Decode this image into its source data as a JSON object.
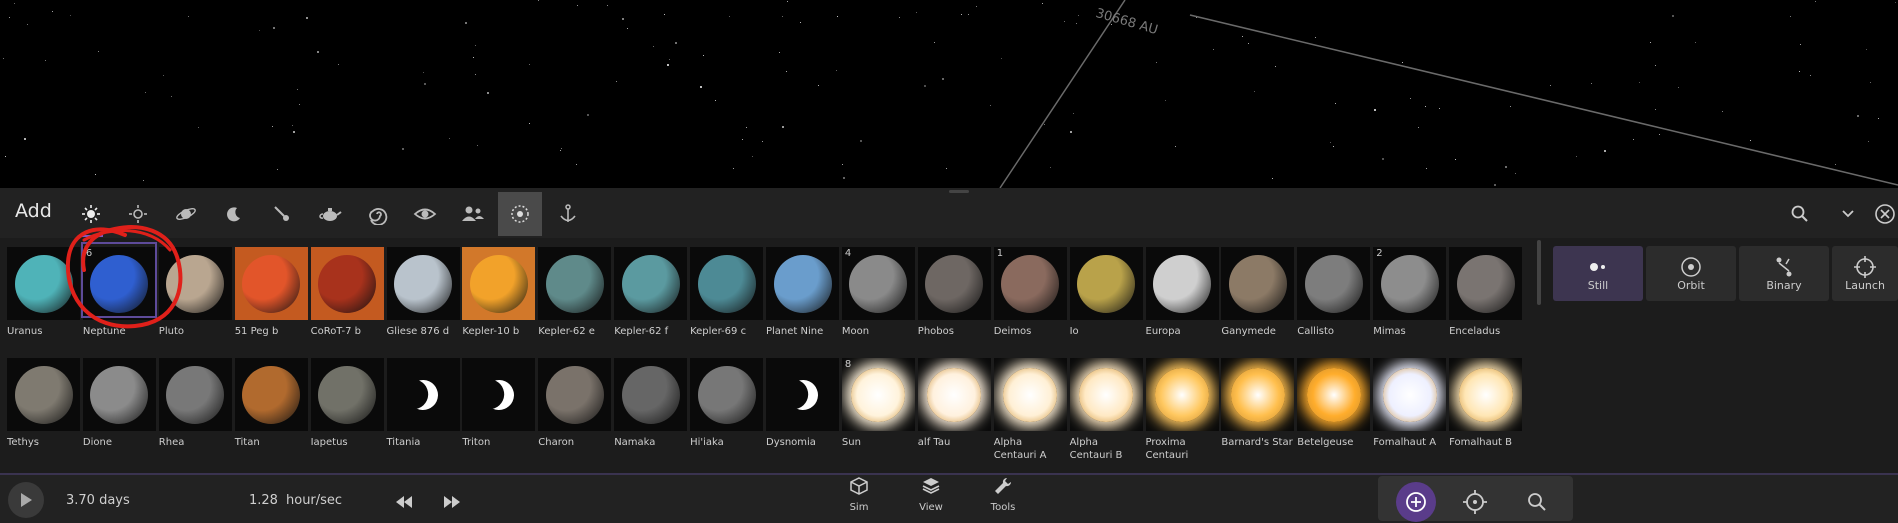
{
  "space": {
    "distance_label": "30668 AU"
  },
  "toolbar": {
    "title": "Add",
    "categories": [
      "stars-galaxies-icon",
      "sun-icon",
      "planet-icon",
      "moon-icon",
      "comet-icon",
      "teapot-icon",
      "spiral-galaxy-icon",
      "eye-icon",
      "people-icon",
      "selected-object-icon",
      "anchor-icon"
    ],
    "search_icon": "search-icon",
    "collapse_icon": "chevron-down-icon",
    "close_icon": "close-icon"
  },
  "objects": [
    {
      "label": "Uranus",
      "color": "#4fb3b8",
      "num": ""
    },
    {
      "label": "Neptune",
      "color": "#2f5fd0",
      "num": "6"
    },
    {
      "label": "Pluto",
      "color": "#b9a690",
      "num": ""
    },
    {
      "label": "51 Peg b",
      "color": "#e2552a",
      "num": ""
    },
    {
      "label": "CoRoT-7 b",
      "color": "#a8321c",
      "num": ""
    },
    {
      "label": "Gliese 876 d",
      "color": "#b9c3cc",
      "num": ""
    },
    {
      "label": "Kepler-10 b",
      "color": "#f2a22a",
      "num": ""
    },
    {
      "label": "Kepler-62 e",
      "color": "#5f8a8a",
      "num": ""
    },
    {
      "label": "Kepler-62 f",
      "color": "#5b9aa0",
      "num": ""
    },
    {
      "label": "Kepler-69 c",
      "color": "#4d8a95",
      "num": ""
    },
    {
      "label": "Planet Nine",
      "color": "#6a9dcc",
      "num": ""
    },
    {
      "label": "Moon",
      "color": "#8a8a8a",
      "num": "4"
    },
    {
      "label": "Phobos",
      "color": "#6e6763",
      "num": ""
    },
    {
      "label": "Deimos",
      "color": "#8a6a5e",
      "num": "1"
    },
    {
      "label": "Io",
      "color": "#b9a24a",
      "num": ""
    },
    {
      "label": "Europa",
      "color": "#cfcfcf",
      "num": ""
    },
    {
      "label": "Ganymede",
      "color": "#8c7a66",
      "num": ""
    },
    {
      "label": "Callisto",
      "color": "#7d7d7d",
      "num": ""
    },
    {
      "label": "Mimas",
      "color": "#8d8d8d",
      "num": "2"
    },
    {
      "label": "Enceladus",
      "color": "#7a7471",
      "num": ""
    },
    {
      "label": "Tethys",
      "color": "#7f7a70",
      "num": ""
    },
    {
      "label": "Dione",
      "color": "#8b8b8b",
      "num": ""
    },
    {
      "label": "Rhea",
      "color": "#787878",
      "num": ""
    },
    {
      "label": "Titan",
      "color": "#b16a2e",
      "num": ""
    },
    {
      "label": "Iapetus",
      "color": "#717168",
      "num": ""
    },
    {
      "label": "Titania",
      "color": "crescent",
      "num": ""
    },
    {
      "label": "Triton",
      "color": "crescent",
      "num": ""
    },
    {
      "label": "Charon",
      "color": "#7a726a",
      "num": ""
    },
    {
      "label": "Namaka",
      "color": "#666",
      "num": ""
    },
    {
      "label": "Hi'iaka",
      "color": "#777",
      "num": ""
    },
    {
      "label": "Dysnomia",
      "color": "crescent",
      "num": ""
    },
    {
      "label": "Sun",
      "color": "#fff3dc",
      "num": "8"
    },
    {
      "label": "alf Tau",
      "color": "#fff1de",
      "num": ""
    },
    {
      "label": "Alpha Centauri A",
      "color": "#fff0d6",
      "num": ""
    },
    {
      "label": "Alpha Centauri B",
      "color": "#ffe9c4",
      "num": ""
    },
    {
      "label": "Proxima Centauri",
      "color": "#ffc860",
      "num": ""
    },
    {
      "label": "Barnard's Star",
      "color": "#ffbf4d",
      "num": ""
    },
    {
      "label": "Betelgeuse",
      "color": "#ffad2c",
      "num": ""
    },
    {
      "label": "Fomalhaut A",
      "color": "#eef0ff",
      "num": ""
    },
    {
      "label": "Fomalhaut B",
      "color": "#ffe6b4",
      "num": ""
    }
  ],
  "modes": [
    {
      "label": "Still",
      "icon": "still-icon"
    },
    {
      "label": "Orbit",
      "icon": "orbit-icon"
    },
    {
      "label": "Binary",
      "icon": "binary-icon"
    },
    {
      "label": "Launch",
      "icon": "launch-icon"
    }
  ],
  "bottom": {
    "time": "3.70 days",
    "rate_value": "1.28",
    "rate_unit": "hour/sec",
    "nav": [
      {
        "label": "Sim",
        "icon": "cube-icon"
      },
      {
        "label": "View",
        "icon": "layers-icon"
      },
      {
        "label": "Tools",
        "icon": "wrench-icon"
      }
    ]
  }
}
